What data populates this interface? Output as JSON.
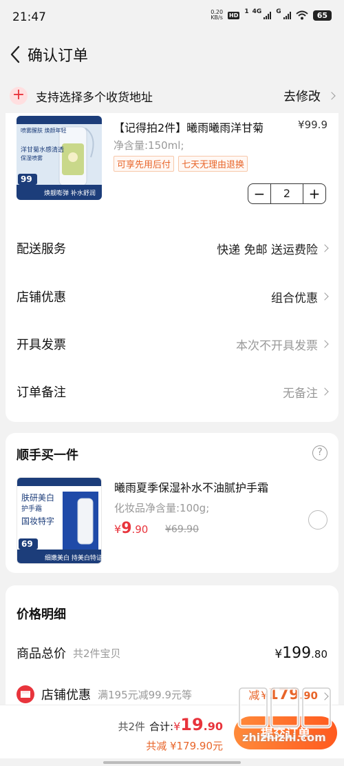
{
  "status": {
    "time": "21:47",
    "net_speed": "0.20",
    "net_unit": "KB/s",
    "hd": "HD",
    "sim1": "1",
    "signal4g": "4G",
    "signal_g": "G",
    "battery": "65"
  },
  "nav": {
    "title": "确认订单"
  },
  "address": {
    "text": "支持选择多个收货地址",
    "edit": "去修改"
  },
  "product1": {
    "name": "【记得拍2件】曦雨曦雨洋甘菊",
    "price": "¥99.9",
    "spec": "净含量:150ml;",
    "tags": [
      "可享先用后付",
      "七天无理由退换"
    ],
    "quantity": "2",
    "image_texts": [
      "喷雾醒肤 焕颜年轻",
      "洋甘菊水感清透",
      "保湿喷雾",
      "99",
      "焕靓嘭弹 补水舒润"
    ]
  },
  "order_rows": [
    {
      "label": "配送服务",
      "value": "快递 免邮 送运费险"
    },
    {
      "label": "店铺优惠",
      "value": "组合优惠"
    },
    {
      "label": "开具发票",
      "value": "本次不开具发票"
    },
    {
      "label": "订单备注",
      "value": "无备注"
    }
  ],
  "addon": {
    "title": "顺手买一件",
    "help": "?",
    "name": "曦雨夏季保湿补水不油腻护手霜",
    "spec": "化妆品净含量:100g;",
    "price_yen": "¥",
    "price_int": "9",
    "price_dec": ".90",
    "orig_price": "¥69.90",
    "image_texts": [
      "肤研美白",
      "护手霜",
      "国妆特字",
      "69",
      "细嫩美白 持美白特证"
    ]
  },
  "price_detail": {
    "title": "价格明细",
    "total_label": "商品总价",
    "total_sub": "共2件宝贝",
    "total_yen": "¥",
    "total_int": "199",
    "total_dec": ".80",
    "discount_label": "店铺优惠",
    "discount_desc": "满195元减99.9元等",
    "discount_prefix": "减",
    "discount_yen": "¥",
    "discount_int": "179",
    "discount_dec": ".90"
  },
  "bottom": {
    "count": "共2件",
    "sum_label": "合计:",
    "sum_yen": "¥",
    "sum_int": "19",
    "sum_dec": ".90",
    "saved": "共减 ¥179.90元",
    "submit": "提交订单"
  },
  "watermark": {
    "text": "值得买",
    "url": "zhizhizhi.com"
  },
  "colors": {
    "accent_red": "#e8343c",
    "accent_orange": "#e8652a",
    "button_gradient_start": "#ff8a3a",
    "button_gradient_end": "#ff5a1f"
  }
}
